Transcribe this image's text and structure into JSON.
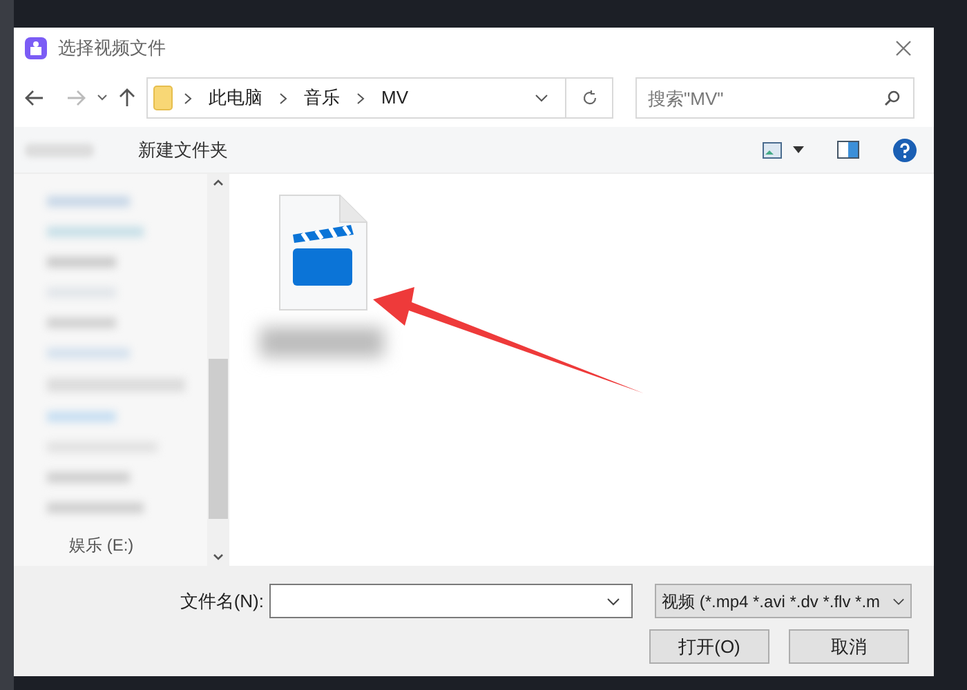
{
  "window": {
    "title": "选择视频文件"
  },
  "address": {
    "crumbs": [
      "此电脑",
      "音乐",
      "MV"
    ]
  },
  "search": {
    "placeholder": "搜索\"MV\""
  },
  "toolbar": {
    "new_folder": "新建文件夹"
  },
  "nav": {
    "visible_item": "娱乐 (E:)"
  },
  "footer": {
    "filename_label": "文件名(N):",
    "filter": "视频 (*.mp4 *.avi *.dv *.flv *.m",
    "open": "打开(O)",
    "cancel": "取消"
  }
}
